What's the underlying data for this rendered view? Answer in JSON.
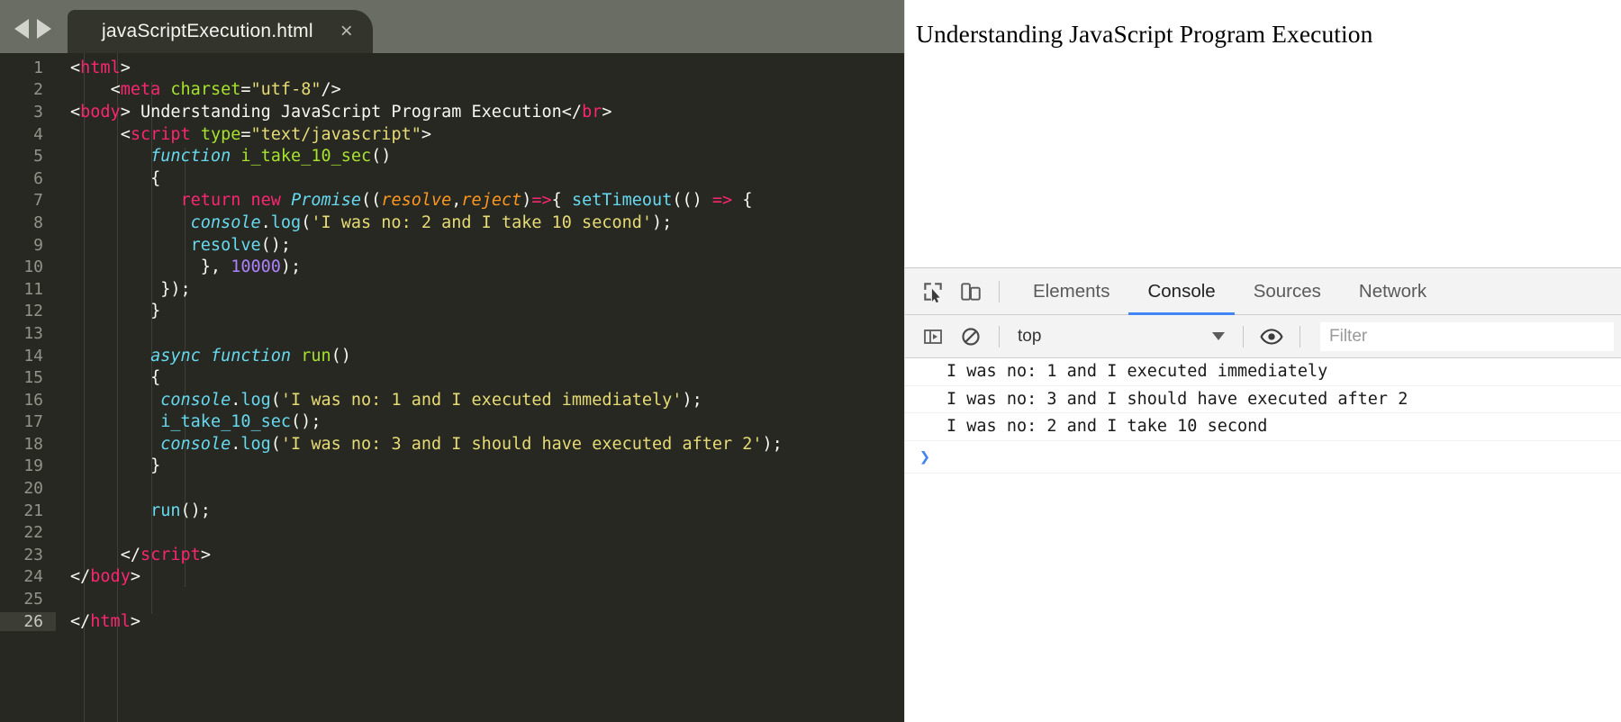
{
  "editor": {
    "tab": {
      "title": "javaScriptExecution.html",
      "close_label": "×"
    },
    "nav": {
      "back_label": "back",
      "forward_label": "forward"
    },
    "active_line": 26,
    "lines": [
      {
        "n": "1",
        "tokens": [
          {
            "t": "t-punc",
            "v": "<"
          },
          {
            "t": "t-tag",
            "v": "html"
          },
          {
            "t": "t-punc",
            "v": ">"
          }
        ],
        "indent": 0
      },
      {
        "n": "2",
        "tokens": [
          {
            "t": "t-plain",
            "v": "    "
          },
          {
            "t": "t-punc",
            "v": "<"
          },
          {
            "t": "t-tag",
            "v": "meta"
          },
          {
            "t": "t-plain",
            "v": " "
          },
          {
            "t": "t-attr",
            "v": "charset"
          },
          {
            "t": "t-punc",
            "v": "="
          },
          {
            "t": "t-str",
            "v": "\"utf-8\""
          },
          {
            "t": "t-punc",
            "v": "/>"
          }
        ],
        "indent": 1
      },
      {
        "n": "3",
        "tokens": [
          {
            "t": "t-punc",
            "v": "<"
          },
          {
            "t": "t-tag",
            "v": "body"
          },
          {
            "t": "t-punc",
            "v": ">"
          },
          {
            "t": "t-plain",
            "v": " Understanding JavaScript Program Execution"
          },
          {
            "t": "t-punc",
            "v": "</"
          },
          {
            "t": "t-tag",
            "v": "br"
          },
          {
            "t": "t-punc",
            "v": ">"
          }
        ],
        "indent": 0
      },
      {
        "n": "4",
        "tokens": [
          {
            "t": "t-plain",
            "v": "     "
          },
          {
            "t": "t-punc",
            "v": "<"
          },
          {
            "t": "t-tag",
            "v": "script"
          },
          {
            "t": "t-plain",
            "v": " "
          },
          {
            "t": "t-attr",
            "v": "type"
          },
          {
            "t": "t-punc",
            "v": "="
          },
          {
            "t": "t-str",
            "v": "\"text/javascript\""
          },
          {
            "t": "t-punc",
            "v": ">"
          }
        ],
        "indent": 1
      },
      {
        "n": "5",
        "tokens": [
          {
            "t": "t-plain",
            "v": "        "
          },
          {
            "t": "t-kw",
            "v": "function"
          },
          {
            "t": "t-plain",
            "v": " "
          },
          {
            "t": "t-fn",
            "v": "i_take_10_sec"
          },
          {
            "t": "t-punc",
            "v": "()"
          }
        ],
        "indent": 2
      },
      {
        "n": "6",
        "tokens": [
          {
            "t": "t-plain",
            "v": "        {"
          }
        ],
        "indent": 2
      },
      {
        "n": "7",
        "tokens": [
          {
            "t": "t-plain",
            "v": "           "
          },
          {
            "t": "t-kw2",
            "v": "return"
          },
          {
            "t": "t-plain",
            "v": " "
          },
          {
            "t": "t-kw2",
            "v": "new"
          },
          {
            "t": "t-plain",
            "v": " "
          },
          {
            "t": "t-cls",
            "v": "Promise"
          },
          {
            "t": "t-punc",
            "v": "(("
          },
          {
            "t": "t-param",
            "v": "resolve"
          },
          {
            "t": "t-punc",
            "v": ","
          },
          {
            "t": "t-param",
            "v": "reject"
          },
          {
            "t": "t-punc",
            "v": ")"
          },
          {
            "t": "t-op",
            "v": "=>"
          },
          {
            "t": "t-punc",
            "v": "{ "
          },
          {
            "t": "t-builtin",
            "v": "setTimeout"
          },
          {
            "t": "t-punc",
            "v": "(() "
          },
          {
            "t": "t-op",
            "v": "=>"
          },
          {
            "t": "t-punc",
            "v": " {"
          }
        ],
        "indent": 3
      },
      {
        "n": "8",
        "tokens": [
          {
            "t": "t-plain",
            "v": "            "
          },
          {
            "t": "t-obj",
            "v": "console"
          },
          {
            "t": "t-punc",
            "v": "."
          },
          {
            "t": "t-builtin",
            "v": "log"
          },
          {
            "t": "t-punc",
            "v": "("
          },
          {
            "t": "t-str",
            "v": "'I was no: 2 and I take 10 second'"
          },
          {
            "t": "t-punc",
            "v": ");"
          }
        ],
        "indent": 3
      },
      {
        "n": "9",
        "tokens": [
          {
            "t": "t-plain",
            "v": "            "
          },
          {
            "t": "t-builtin",
            "v": "resolve"
          },
          {
            "t": "t-punc",
            "v": "();"
          }
        ],
        "indent": 3
      },
      {
        "n": "10",
        "tokens": [
          {
            "t": "t-plain",
            "v": "             },"
          },
          {
            "t": "t-plain",
            "v": " "
          },
          {
            "t": "t-num",
            "v": "10000"
          },
          {
            "t": "t-punc",
            "v": ");"
          }
        ],
        "indent": 3
      },
      {
        "n": "11",
        "tokens": [
          {
            "t": "t-plain",
            "v": "         });"
          }
        ],
        "indent": 3
      },
      {
        "n": "12",
        "tokens": [
          {
            "t": "t-plain",
            "v": "        }"
          }
        ],
        "indent": 2
      },
      {
        "n": "13",
        "tokens": [
          {
            "t": "t-plain",
            "v": ""
          }
        ],
        "indent": 2
      },
      {
        "n": "14",
        "tokens": [
          {
            "t": "t-plain",
            "v": "        "
          },
          {
            "t": "t-kw",
            "v": "async function"
          },
          {
            "t": "t-plain",
            "v": " "
          },
          {
            "t": "t-fn",
            "v": "run"
          },
          {
            "t": "t-punc",
            "v": "()"
          }
        ],
        "indent": 2
      },
      {
        "n": "15",
        "tokens": [
          {
            "t": "t-plain",
            "v": "        {"
          }
        ],
        "indent": 2
      },
      {
        "n": "16",
        "tokens": [
          {
            "t": "t-plain",
            "v": "         "
          },
          {
            "t": "t-obj",
            "v": "console"
          },
          {
            "t": "t-punc",
            "v": "."
          },
          {
            "t": "t-builtin",
            "v": "log"
          },
          {
            "t": "t-punc",
            "v": "("
          },
          {
            "t": "t-str",
            "v": "'I was no: 1 and I executed immediately'"
          },
          {
            "t": "t-punc",
            "v": ");"
          }
        ],
        "indent": 3
      },
      {
        "n": "17",
        "tokens": [
          {
            "t": "t-plain",
            "v": "         "
          },
          {
            "t": "t-builtin",
            "v": "i_take_10_sec"
          },
          {
            "t": "t-punc",
            "v": "();"
          }
        ],
        "indent": 3
      },
      {
        "n": "18",
        "tokens": [
          {
            "t": "t-plain",
            "v": "         "
          },
          {
            "t": "t-obj",
            "v": "console"
          },
          {
            "t": "t-punc",
            "v": "."
          },
          {
            "t": "t-builtin",
            "v": "log"
          },
          {
            "t": "t-punc",
            "v": "("
          },
          {
            "t": "t-str",
            "v": "'I was no: 3 and I should have executed after 2'"
          },
          {
            "t": "t-punc",
            "v": ");"
          }
        ],
        "indent": 3
      },
      {
        "n": "19",
        "tokens": [
          {
            "t": "t-plain",
            "v": "        }"
          }
        ],
        "indent": 2
      },
      {
        "n": "20",
        "tokens": [
          {
            "t": "t-plain",
            "v": ""
          }
        ],
        "indent": 2
      },
      {
        "n": "21",
        "tokens": [
          {
            "t": "t-plain",
            "v": "        "
          },
          {
            "t": "t-builtin",
            "v": "run"
          },
          {
            "t": "t-punc",
            "v": "();"
          }
        ],
        "indent": 2
      },
      {
        "n": "22",
        "tokens": [
          {
            "t": "t-plain",
            "v": ""
          }
        ],
        "indent": 2
      },
      {
        "n": "23",
        "tokens": [
          {
            "t": "t-plain",
            "v": "     "
          },
          {
            "t": "t-punc",
            "v": "</"
          },
          {
            "t": "t-tag",
            "v": "script"
          },
          {
            "t": "t-punc",
            "v": ">"
          }
        ],
        "indent": 1
      },
      {
        "n": "24",
        "tokens": [
          {
            "t": "t-punc",
            "v": "</"
          },
          {
            "t": "t-tag",
            "v": "body"
          },
          {
            "t": "t-punc",
            "v": ">"
          }
        ],
        "indent": 0
      },
      {
        "n": "25",
        "tokens": [
          {
            "t": "t-plain",
            "v": ""
          }
        ],
        "indent": 0
      },
      {
        "n": "26",
        "tokens": [
          {
            "t": "t-punc",
            "v": "</"
          },
          {
            "t": "t-tag",
            "v": "html"
          },
          {
            "t": "t-punc",
            "v": ">"
          }
        ],
        "indent": 0
      }
    ]
  },
  "browser": {
    "page_heading": "Understanding JavaScript Program Execution",
    "devtools": {
      "inspect_icon": "inspect-element-icon",
      "device_icon": "device-toolbar-icon",
      "tabs": [
        {
          "label": "Elements",
          "active": false
        },
        {
          "label": "Console",
          "active": true
        },
        {
          "label": "Sources",
          "active": false
        },
        {
          "label": "Network",
          "active": false
        }
      ],
      "filterbar": {
        "sidebar_icon": "console-sidebar-icon",
        "clear_icon": "clear-console-icon",
        "context": "top",
        "eye_icon": "live-expression-icon",
        "filter_placeholder": "Filter",
        "filter_value": ""
      },
      "console_messages": [
        "I was no: 1 and I executed immediately",
        "I was no: 3 and I should have executed after 2",
        "I was no: 2 and I take 10 second"
      ],
      "prompt_chevron": "❯"
    }
  },
  "colors": {
    "editor_bg": "#272822",
    "tabbar_bg": "#6a6d64",
    "tab_active_bg": "#33342c",
    "accent_blue": "#4285f4",
    "devtools_bg": "#f3f3f3"
  }
}
